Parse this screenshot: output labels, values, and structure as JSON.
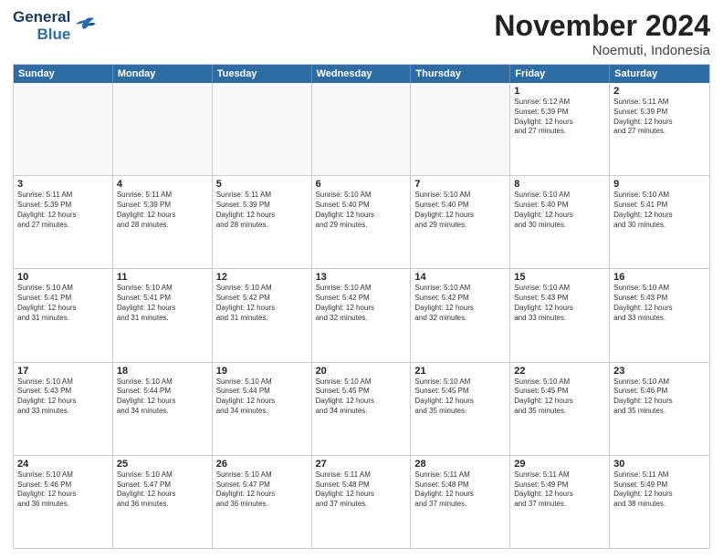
{
  "logo": {
    "line1": "General",
    "line2": "Blue"
  },
  "title": "November 2024",
  "subtitle": "Noemuti, Indonesia",
  "days": [
    "Sunday",
    "Monday",
    "Tuesday",
    "Wednesday",
    "Thursday",
    "Friday",
    "Saturday"
  ],
  "weeks": [
    [
      {
        "day": "",
        "info": ""
      },
      {
        "day": "",
        "info": ""
      },
      {
        "day": "",
        "info": ""
      },
      {
        "day": "",
        "info": ""
      },
      {
        "day": "",
        "info": ""
      },
      {
        "day": "1",
        "info": "Sunrise: 5:12 AM\nSunset: 5:39 PM\nDaylight: 12 hours\nand 27 minutes."
      },
      {
        "day": "2",
        "info": "Sunrise: 5:11 AM\nSunset: 5:39 PM\nDaylight: 12 hours\nand 27 minutes."
      }
    ],
    [
      {
        "day": "3",
        "info": "Sunrise: 5:11 AM\nSunset: 5:39 PM\nDaylight: 12 hours\nand 27 minutes."
      },
      {
        "day": "4",
        "info": "Sunrise: 5:11 AM\nSunset: 5:39 PM\nDaylight: 12 hours\nand 28 minutes."
      },
      {
        "day": "5",
        "info": "Sunrise: 5:11 AM\nSunset: 5:39 PM\nDaylight: 12 hours\nand 28 minutes."
      },
      {
        "day": "6",
        "info": "Sunrise: 5:10 AM\nSunset: 5:40 PM\nDaylight: 12 hours\nand 29 minutes."
      },
      {
        "day": "7",
        "info": "Sunrise: 5:10 AM\nSunset: 5:40 PM\nDaylight: 12 hours\nand 29 minutes."
      },
      {
        "day": "8",
        "info": "Sunrise: 5:10 AM\nSunset: 5:40 PM\nDaylight: 12 hours\nand 30 minutes."
      },
      {
        "day": "9",
        "info": "Sunrise: 5:10 AM\nSunset: 5:41 PM\nDaylight: 12 hours\nand 30 minutes."
      }
    ],
    [
      {
        "day": "10",
        "info": "Sunrise: 5:10 AM\nSunset: 5:41 PM\nDaylight: 12 hours\nand 31 minutes."
      },
      {
        "day": "11",
        "info": "Sunrise: 5:10 AM\nSunset: 5:41 PM\nDaylight: 12 hours\nand 31 minutes."
      },
      {
        "day": "12",
        "info": "Sunrise: 5:10 AM\nSunset: 5:42 PM\nDaylight: 12 hours\nand 31 minutes."
      },
      {
        "day": "13",
        "info": "Sunrise: 5:10 AM\nSunset: 5:42 PM\nDaylight: 12 hours\nand 32 minutes."
      },
      {
        "day": "14",
        "info": "Sunrise: 5:10 AM\nSunset: 5:42 PM\nDaylight: 12 hours\nand 32 minutes."
      },
      {
        "day": "15",
        "info": "Sunrise: 5:10 AM\nSunset: 5:43 PM\nDaylight: 12 hours\nand 33 minutes."
      },
      {
        "day": "16",
        "info": "Sunrise: 5:10 AM\nSunset: 5:43 PM\nDaylight: 12 hours\nand 33 minutes."
      }
    ],
    [
      {
        "day": "17",
        "info": "Sunrise: 5:10 AM\nSunset: 5:43 PM\nDaylight: 12 hours\nand 33 minutes."
      },
      {
        "day": "18",
        "info": "Sunrise: 5:10 AM\nSunset: 5:44 PM\nDaylight: 12 hours\nand 34 minutes."
      },
      {
        "day": "19",
        "info": "Sunrise: 5:10 AM\nSunset: 5:44 PM\nDaylight: 12 hours\nand 34 minutes."
      },
      {
        "day": "20",
        "info": "Sunrise: 5:10 AM\nSunset: 5:45 PM\nDaylight: 12 hours\nand 34 minutes."
      },
      {
        "day": "21",
        "info": "Sunrise: 5:10 AM\nSunset: 5:45 PM\nDaylight: 12 hours\nand 35 minutes."
      },
      {
        "day": "22",
        "info": "Sunrise: 5:10 AM\nSunset: 5:45 PM\nDaylight: 12 hours\nand 35 minutes."
      },
      {
        "day": "23",
        "info": "Sunrise: 5:10 AM\nSunset: 5:46 PM\nDaylight: 12 hours\nand 35 minutes."
      }
    ],
    [
      {
        "day": "24",
        "info": "Sunrise: 5:10 AM\nSunset: 5:46 PM\nDaylight: 12 hours\nand 36 minutes."
      },
      {
        "day": "25",
        "info": "Sunrise: 5:10 AM\nSunset: 5:47 PM\nDaylight: 12 hours\nand 36 minutes."
      },
      {
        "day": "26",
        "info": "Sunrise: 5:10 AM\nSunset: 5:47 PM\nDaylight: 12 hours\nand 36 minutes."
      },
      {
        "day": "27",
        "info": "Sunrise: 5:11 AM\nSunset: 5:48 PM\nDaylight: 12 hours\nand 37 minutes."
      },
      {
        "day": "28",
        "info": "Sunrise: 5:11 AM\nSunset: 5:48 PM\nDaylight: 12 hours\nand 37 minutes."
      },
      {
        "day": "29",
        "info": "Sunrise: 5:11 AM\nSunset: 5:49 PM\nDaylight: 12 hours\nand 37 minutes."
      },
      {
        "day": "30",
        "info": "Sunrise: 5:11 AM\nSunset: 5:49 PM\nDaylight: 12 hours\nand 38 minutes."
      }
    ]
  ]
}
